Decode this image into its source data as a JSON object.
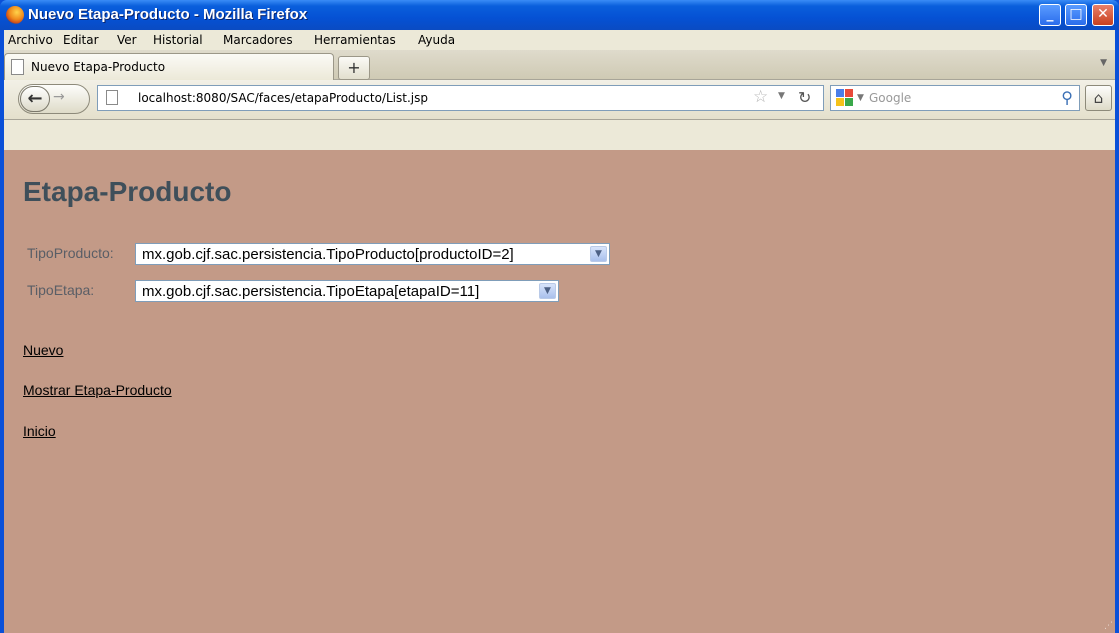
{
  "window": {
    "title": "Nuevo Etapa-Producto - Mozilla Firefox",
    "controls": {
      "minimize": "_",
      "maximize": "□",
      "close": "✕"
    }
  },
  "menubar": {
    "items": [
      {
        "label": "Archivo"
      },
      {
        "label": "Editar"
      },
      {
        "label": "Ver"
      },
      {
        "label": "Historial"
      },
      {
        "label": "Marcadores"
      },
      {
        "label": "Herramientas"
      },
      {
        "label": "Ayuda"
      }
    ]
  },
  "tabs": {
    "items": [
      {
        "label": "Nuevo Etapa-Producto",
        "active": true
      }
    ],
    "new_tab_label": "+"
  },
  "navbar": {
    "url": "localhost:8080/SAC/faces/etapaProducto/List.jsp",
    "search_placeholder": "Google",
    "icons": [
      "back-icon",
      "forward-icon",
      "page-icon",
      "star-icon",
      "reload-icon",
      "google-icon",
      "magnifier-icon",
      "home-icon"
    ]
  },
  "page": {
    "title": "Etapa-Producto",
    "fields": [
      {
        "label": "TipoProducto:",
        "value": "mx.gob.cjf.sac.persistencia.TipoProducto[productoID=2]"
      },
      {
        "label": "TipoEtapa:",
        "value": "mx.gob.cjf.sac.persistencia.TipoEtapa[etapaID=11]"
      }
    ],
    "links": [
      {
        "label": "Nuevo"
      },
      {
        "label": "Mostrar Etapa-Producto"
      },
      {
        "label": "Inicio"
      }
    ]
  },
  "colors": {
    "page_background": "#c39a87",
    "title_color": "#3f4f5a",
    "titlebar_blue": "#0551d4"
  }
}
